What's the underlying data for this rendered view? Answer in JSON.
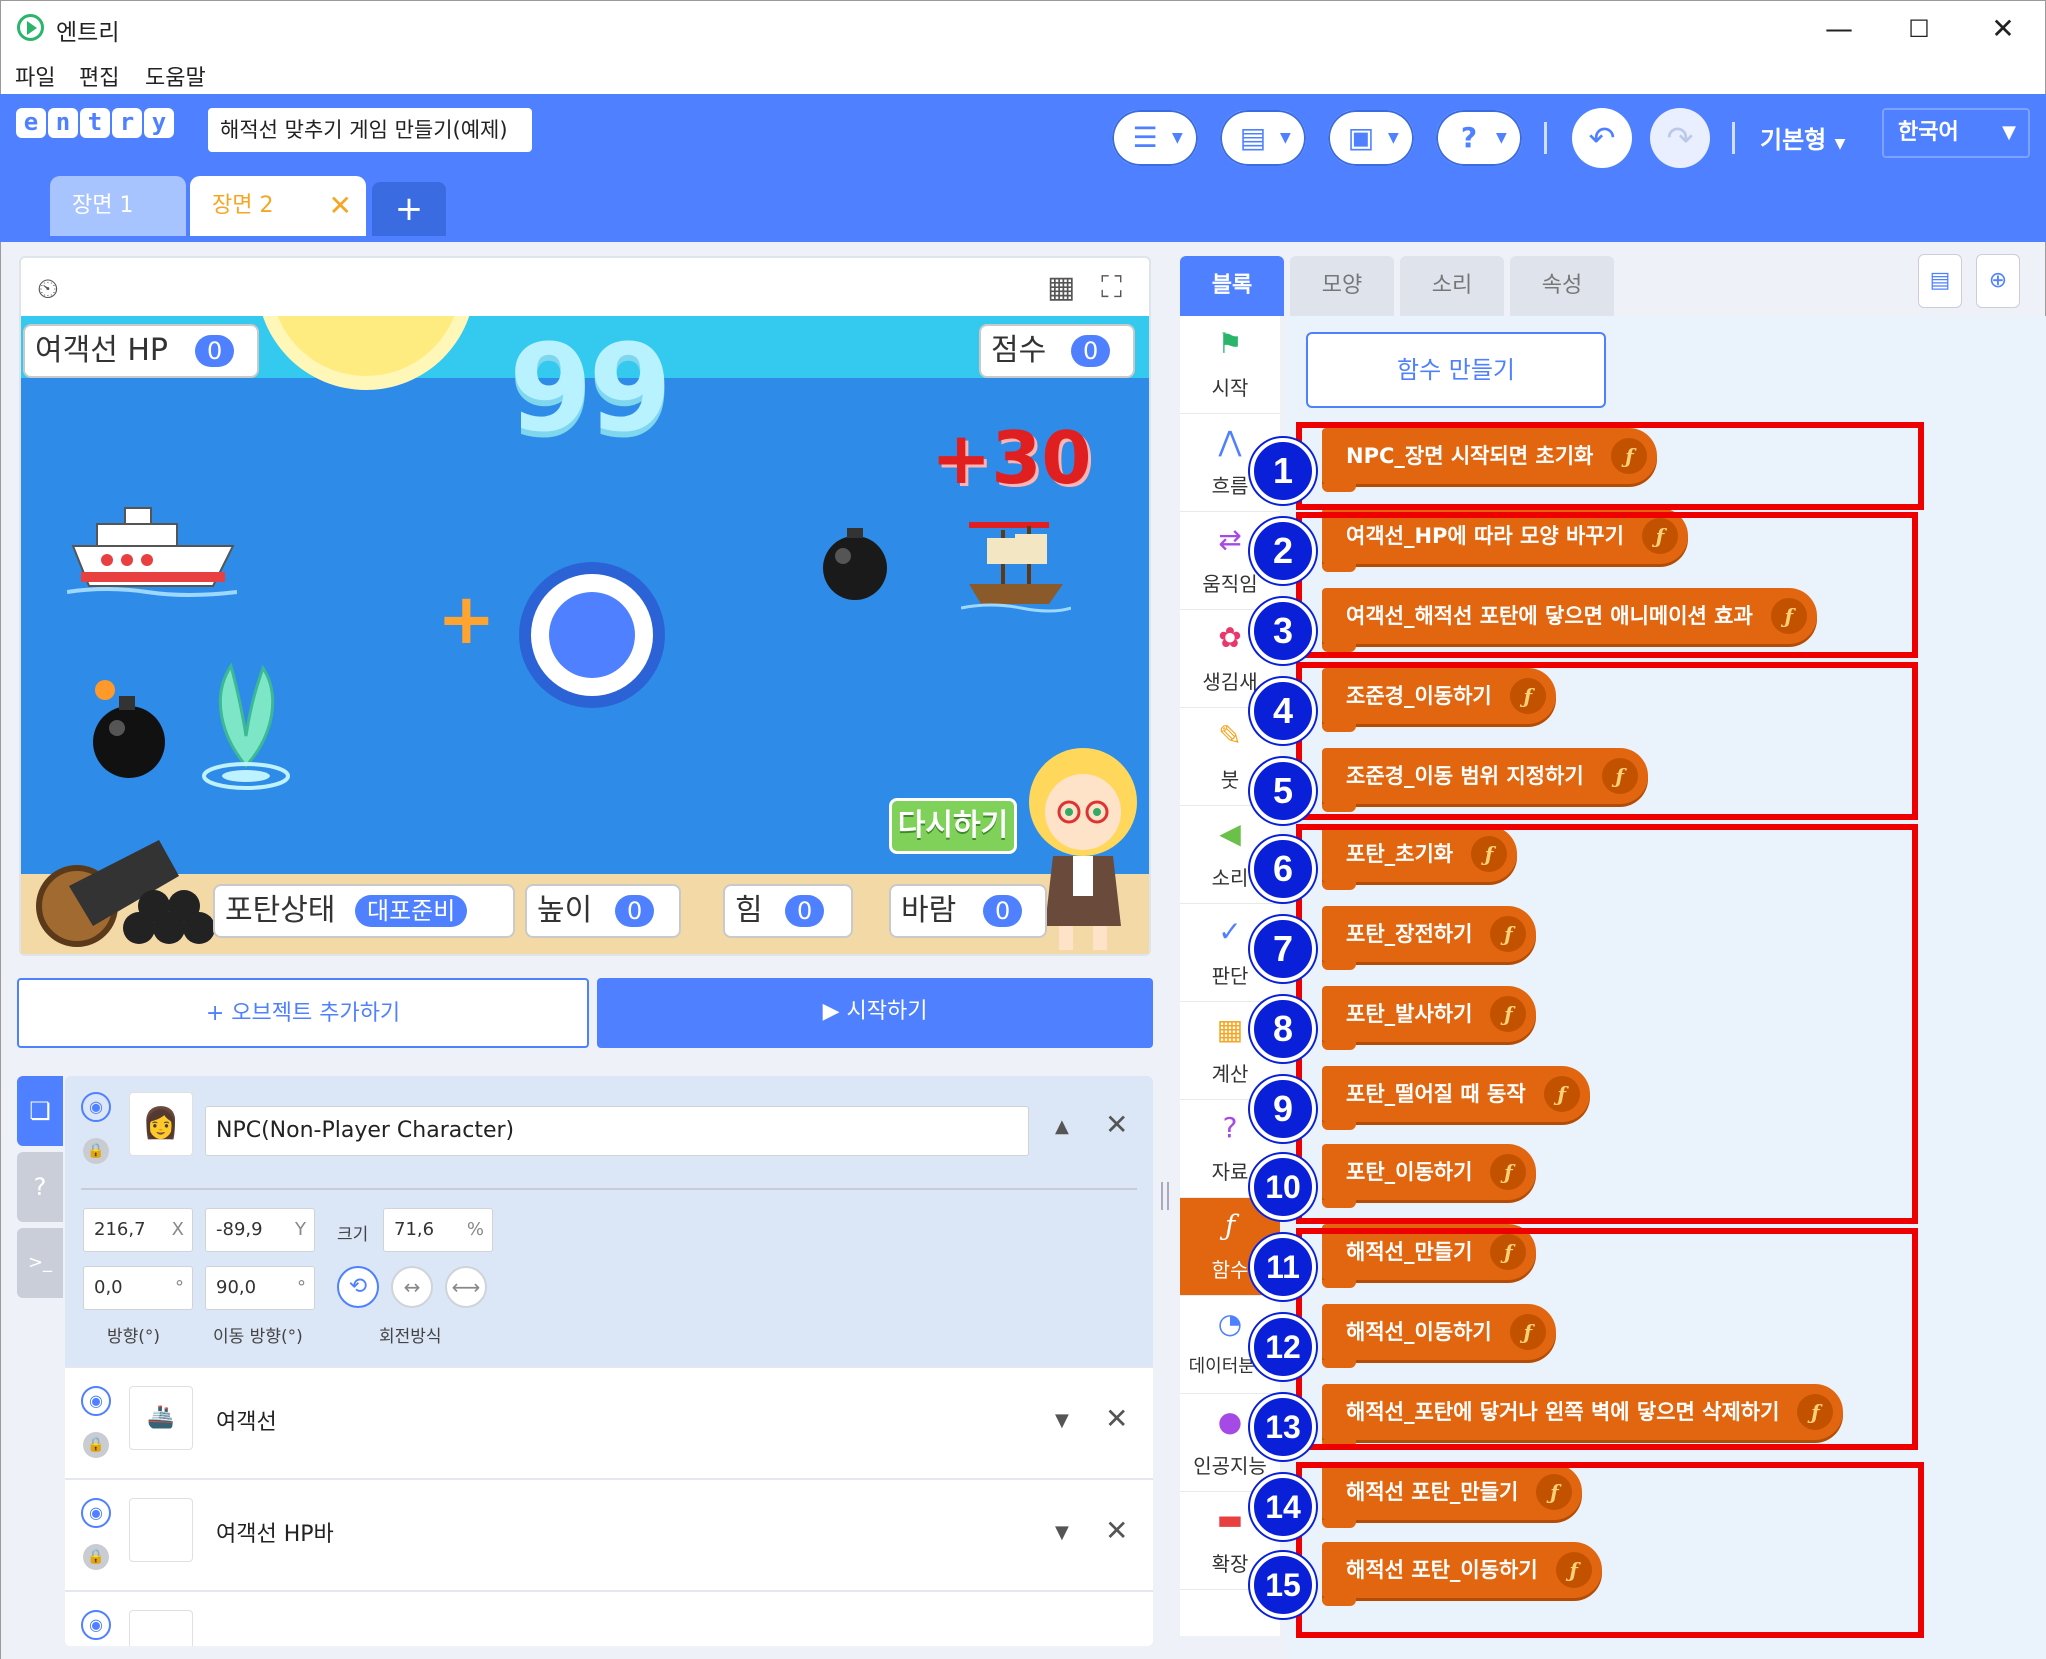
{
  "window": {
    "title": "엔트리",
    "minimize": "—",
    "maximize": "☐",
    "close": "✕"
  },
  "menu": [
    "파일",
    "편집",
    "도움말"
  ],
  "header": {
    "logo_letters": [
      "e",
      "n",
      "t",
      "r",
      "y"
    ],
    "project_title": "해적선 맞추기 게임 만들기(예제)",
    "mode": "기본형",
    "language": "한국어",
    "help_glyph": "?"
  },
  "scenes": [
    {
      "label": "장면 1",
      "active": false
    },
    {
      "label": "장면 2",
      "active": true
    }
  ],
  "stage": {
    "variables": [
      {
        "label": "여객선 HP",
        "value": "0"
      },
      {
        "label": "점수",
        "value": "0"
      },
      {
        "label": "포탄상태",
        "value": "대포준비"
      },
      {
        "label": "높이",
        "value": "0"
      },
      {
        "label": "힘",
        "value": "0"
      },
      {
        "label": "바람",
        "value": "0"
      }
    ],
    "timer": "99",
    "score_popup": "+30",
    "retry_button": "다시하기"
  },
  "actions": {
    "add_object": "+ 오브젝트 추가하기",
    "start": "▶ 시작하기"
  },
  "objects": {
    "selected": {
      "name": "NPC(Non-Player Character)",
      "x": "216,7",
      "y": "-89,9",
      "size": "71,6",
      "direction": "0,0",
      "move_direction": "90,0",
      "labels": {
        "x": "X",
        "y": "Y",
        "size": "크기",
        "percent": "%",
        "degree": "°",
        "direction": "방향(°)",
        "move_direction": "이동 방향(°)",
        "rotation": "회전방식"
      }
    },
    "rows": [
      {
        "name": "여객선"
      },
      {
        "name": "여객선 HP바"
      }
    ]
  },
  "right_tabs": [
    "블록",
    "모양",
    "소리",
    "속성"
  ],
  "categories": [
    "시작",
    "흐름",
    "움직임",
    "생김새",
    "붓",
    "소리",
    "판단",
    "계산",
    "자료",
    "함수",
    "데이터분석",
    "인공지능",
    "확장"
  ],
  "palette": {
    "make_function": "함수 만들기",
    "function_glyph": "ƒ",
    "functions": [
      "NPC_장면 시작되면 초기화",
      "여객선_HP에 따라 모양 바꾸기",
      "여객선_해적선 포탄에 닿으면 애니메이션 효과",
      "조준경_이동하기",
      "조준경_이동 범위 지정하기",
      "포탄_초기화",
      "포탄_장전하기",
      "포탄_발사하기",
      "포탄_떨어질 때 동작",
      "포탄_이동하기",
      "해적선_만들기",
      "해적선_이동하기",
      "해적선_포탄에 닿거나 왼쪽 벽에 닿으면 삭제하기",
      "해적선 포탄_만들기",
      "해적선 포탄_이동하기"
    ],
    "badges": [
      "1",
      "2",
      "3",
      "4",
      "5",
      "6",
      "7",
      "8",
      "9",
      "10",
      "11",
      "12",
      "13",
      "14",
      "15"
    ]
  },
  "colors": {
    "accent": "#4f80ff",
    "function_block": "#e2660f",
    "annotation_red": "#ee0000",
    "badge": "#0a1fd8"
  }
}
